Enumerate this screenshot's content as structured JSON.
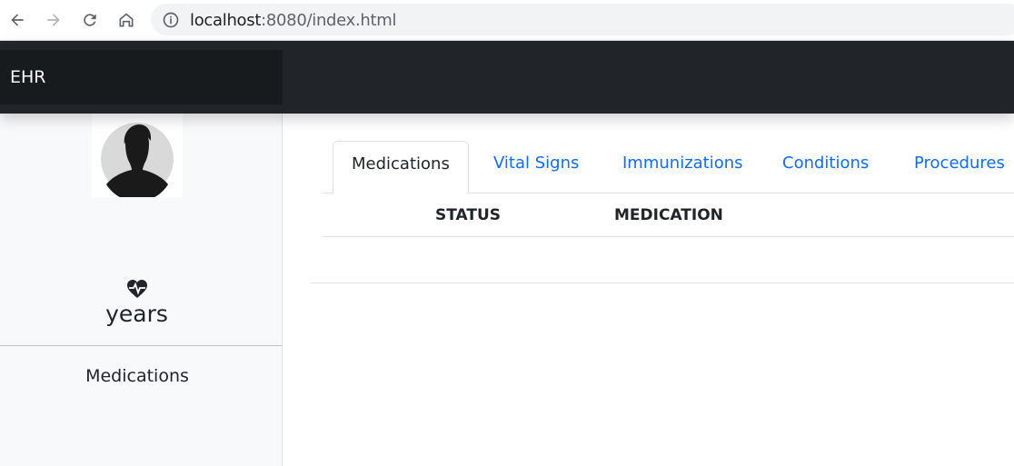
{
  "browser": {
    "url_host": "localhost",
    "url_rest": ":8080/index.html",
    "icons": [
      "back-arrow-icon",
      "forward-arrow-icon",
      "reload-icon",
      "home-icon",
      "info-icon"
    ]
  },
  "navbar": {
    "brand": "EHR"
  },
  "sidebar": {
    "age_unit": "years",
    "section_label": "Medications",
    "icons": [
      "avatar-silhouette-icon",
      "heartbeat-icon"
    ]
  },
  "tabs": [
    {
      "label": "Medications",
      "active": true
    },
    {
      "label": "Vital Signs",
      "active": false
    },
    {
      "label": "Immunizations",
      "active": false
    },
    {
      "label": "Conditions",
      "active": false
    },
    {
      "label": "Procedures",
      "active": false
    }
  ],
  "table": {
    "headers": [
      "STATUS",
      "MEDICATION"
    ],
    "rows": []
  },
  "colors": {
    "navbar": "#212529",
    "link": "#0d6efd",
    "sidebar": "#f8f9fa"
  }
}
